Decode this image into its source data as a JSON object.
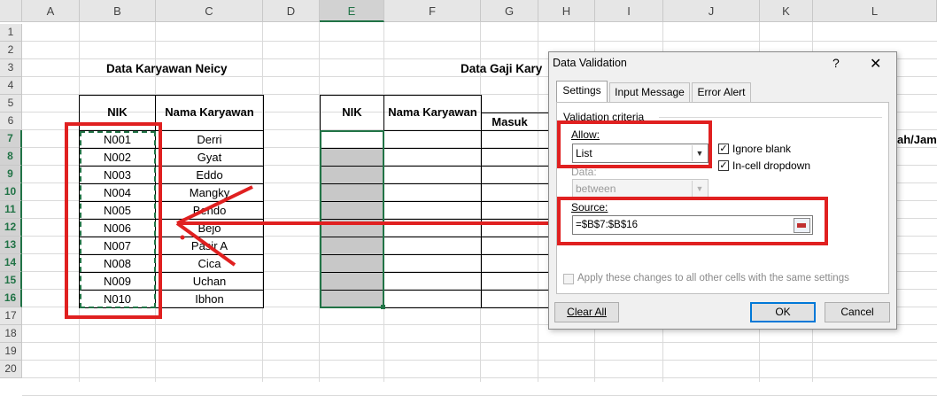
{
  "sheet": {
    "columns": [
      "A",
      "B",
      "C",
      "D",
      "E",
      "F",
      "G",
      "H",
      "I",
      "J",
      "K",
      "L"
    ],
    "selected_column": "E",
    "rows": [
      "1",
      "2",
      "3",
      "4",
      "5",
      "6",
      "7",
      "8",
      "9",
      "10",
      "11",
      "12",
      "13",
      "14",
      "15",
      "16",
      "17",
      "18",
      "19",
      "20"
    ],
    "selected_rows": [
      "7",
      "8",
      "9",
      "10",
      "11",
      "12",
      "13",
      "14",
      "15",
      "16"
    ]
  },
  "table1": {
    "title": "Data Karyawan Neicy",
    "headers": [
      "NIK",
      "Nama Karyawan"
    ],
    "nik": [
      "N001",
      "N002",
      "N003",
      "N004",
      "N005",
      "N006",
      "N007",
      "N008",
      "N009",
      "N010"
    ],
    "names": [
      "Derri",
      "Gyat",
      "Eddo",
      "Mangky",
      "Bendo",
      "Bejo",
      "Pasir A",
      "Cica",
      "Uchan",
      "Ibhon"
    ]
  },
  "table2": {
    "title": "Data Gaji Kary",
    "headers": [
      "NIK",
      "Nama Karyawan",
      "Masuk"
    ],
    "partial_header_right": "ah/Jam"
  },
  "dialog": {
    "title": "Data Validation",
    "help": "?",
    "close": "✕",
    "tabs": [
      "Settings",
      "Input Message",
      "Error Alert"
    ],
    "criteria_label": "Validation criteria",
    "allow_label": "Allow:",
    "allow_value": "List",
    "ignore_blank_label": "Ignore blank",
    "ignore_blank_checked": true,
    "incell_label": "In-cell dropdown",
    "incell_checked": true,
    "data_label": "Data:",
    "data_value": "between",
    "source_label": "Source:",
    "source_value": "=$B$7:$B$16",
    "apply_label": "Apply these changes to all other cells with the same settings",
    "clear_all": "Clear All",
    "ok": "OK",
    "cancel": "Cancel"
  },
  "colors": {
    "annotation_red": "#e02020",
    "excel_green": "#217346",
    "selection_gray": "#c8c8c8"
  }
}
